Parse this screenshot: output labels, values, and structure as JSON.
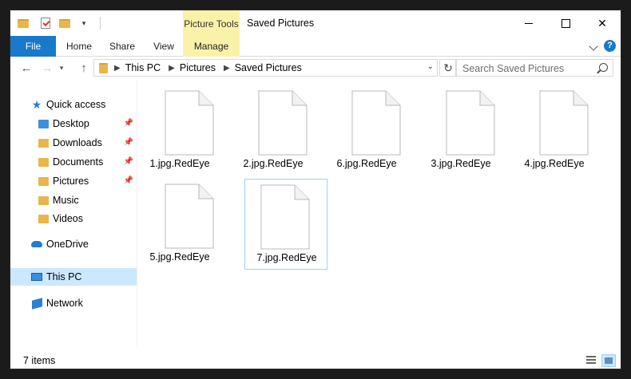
{
  "window": {
    "title": "Saved Pictures",
    "context_tab_group": "Picture Tools"
  },
  "ribbon": {
    "tabs": [
      "File",
      "Home",
      "Share",
      "View",
      "Manage"
    ],
    "help": "?"
  },
  "address": {
    "crumbs": [
      "This PC",
      "Pictures",
      "Saved Pictures"
    ],
    "search_placeholder": "Search Saved Pictures"
  },
  "sidebar": {
    "items": [
      {
        "label": "Quick access",
        "icon": "star-icon"
      },
      {
        "label": "Desktop",
        "icon": "desktop-folder-icon",
        "pinned": true
      },
      {
        "label": "Downloads",
        "icon": "downloads-folder-icon",
        "pinned": true
      },
      {
        "label": "Documents",
        "icon": "documents-folder-icon",
        "pinned": true
      },
      {
        "label": "Pictures",
        "icon": "pictures-folder-icon",
        "pinned": true
      },
      {
        "label": "Music",
        "icon": "music-folder-icon"
      },
      {
        "label": "Videos",
        "icon": "videos-folder-icon"
      },
      {
        "label": "OneDrive",
        "icon": "cloud-icon"
      },
      {
        "label": "This PC",
        "icon": "computer-icon",
        "selected": true
      },
      {
        "label": "Network",
        "icon": "network-icon"
      }
    ]
  },
  "files": [
    {
      "name": "1.jpg.RedEye"
    },
    {
      "name": "2.jpg.RedEye"
    },
    {
      "name": "6.jpg.RedEye"
    },
    {
      "name": "3.jpg.RedEye"
    },
    {
      "name": "4.jpg.RedEye"
    },
    {
      "name": "5.jpg.RedEye"
    },
    {
      "name": "7.jpg.RedEye",
      "selected": true
    }
  ],
  "status": {
    "item_count": "7 items"
  },
  "colors": {
    "accent": "#1979ca",
    "context_tab": "#fbf2a9",
    "selection": "#cce8ff"
  }
}
